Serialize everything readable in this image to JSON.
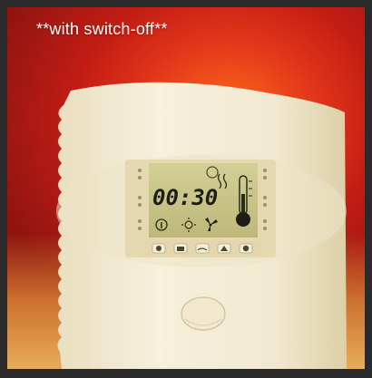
{
  "caption": "**with switch-off**",
  "display": {
    "time": "00:30"
  },
  "colors": {
    "background_red": "#c41d14",
    "device_body": "#f3ecd3",
    "lcd_screen": "#c9c58a"
  },
  "icons": [
    "sauna-icon",
    "temperature-gauge-icon",
    "info-icon",
    "sun-icon",
    "fan-icon",
    "light-button-icon",
    "heater-button-icon",
    "evaporator-button-icon",
    "fan-button-icon",
    "timer-button-icon"
  ]
}
